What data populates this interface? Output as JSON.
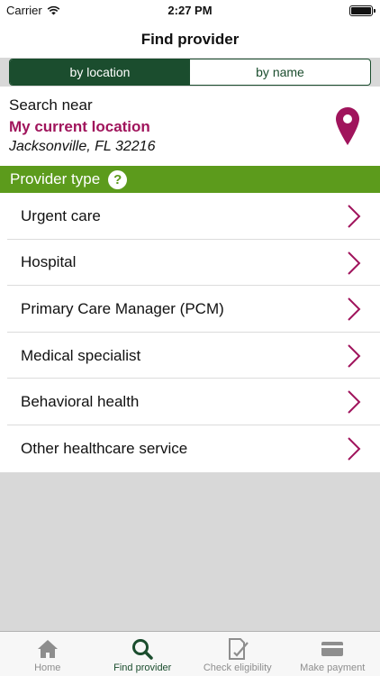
{
  "status": {
    "carrier": "Carrier",
    "time": "2:27 PM"
  },
  "nav": {
    "title": "Find provider"
  },
  "segments": {
    "location": "by location",
    "name": "by name"
  },
  "search": {
    "label": "Search near",
    "current_location": "My current location",
    "city": "Jacksonville, FL 32216"
  },
  "section": {
    "title": "Provider type",
    "help": "?"
  },
  "providers": [
    {
      "label": "Urgent care"
    },
    {
      "label": "Hospital"
    },
    {
      "label": "Primary Care Manager (PCM)"
    },
    {
      "label": "Medical specialist"
    },
    {
      "label": "Behavioral health"
    },
    {
      "label": "Other healthcare service"
    }
  ],
  "tabs": [
    {
      "label": "Home",
      "icon": "home-icon"
    },
    {
      "label": "Find provider",
      "icon": "search-icon"
    },
    {
      "label": "Check eligibility",
      "icon": "check-eligibility-icon"
    },
    {
      "label": "Make payment",
      "icon": "credit-card-icon"
    }
  ],
  "colors": {
    "green_dark": "#1b4d2e",
    "green_header": "#5c9b1c",
    "magenta": "#a0145c",
    "tab_inactive": "#8e8e8e"
  }
}
